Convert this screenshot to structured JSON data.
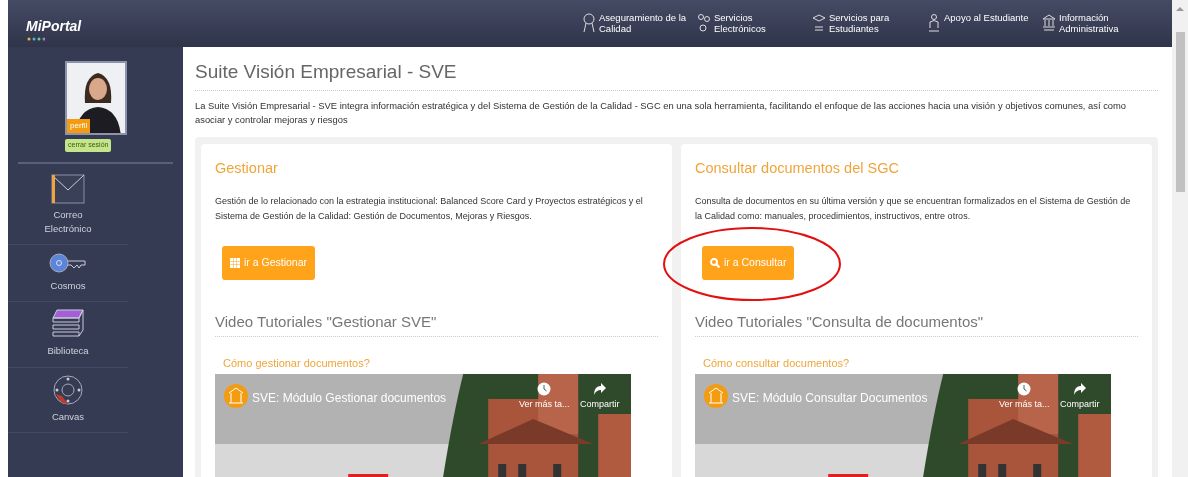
{
  "brand": {
    "text": "MiPortal"
  },
  "nav": [
    {
      "label": "Aseguramiento de la Calidad"
    },
    {
      "label": "Servicios Electrónicos"
    },
    {
      "label": "Servicios para Estudiantes"
    },
    {
      "label": "Apoyo al Estudiante"
    },
    {
      "label": "Información Administrativa"
    }
  ],
  "profile": {
    "edit_label": "perfil",
    "logout_label": "cerrar sesión"
  },
  "sidebar": {
    "items": [
      {
        "label": "Correo Electrónico"
      },
      {
        "label": "Cosmos"
      },
      {
        "label": "Biblioteca"
      },
      {
        "label": "Canvas"
      }
    ]
  },
  "page": {
    "title": "Suite Visión Empresarial - SVE",
    "intro": "La Suite Visión Empresarial - SVE integra información estratégica y del Sistema de Gestión de la Calidad - SGC en una sola herramienta, facilitando el enfoque de las acciones hacia una visión y objetivos comunes, así como asociar y controlar mejoras y riesgos"
  },
  "cards": [
    {
      "title": "Gestionar",
      "description": "Gestión de lo relacionado con la estrategia institucional: Balanced Score Card y Proyectos estratégicos y el Sistema de Gestión de la Calidad: Gestión de Documentos, Mejoras y Riesgos.",
      "button": "ir a Gestionar",
      "circled": false,
      "videos_heading": "Video Tutoriales \"Gestionar SVE\"",
      "video": {
        "link": "Cómo gestionar documentos?",
        "title": "SVE: Módulo Gestionar documentos",
        "more": "Ver más ta...",
        "share": "Compartir"
      }
    },
    {
      "title": "Consultar documentos del SGC",
      "description": "Consulta de documentos en su última versión y que se encuentran formalizados en el Sistema de Gestión de la Calidad como: manuales, procedimientos, instructivos, entre otros.",
      "button": "ir a Consultar",
      "circled": true,
      "videos_heading": "Video Tutoriales \"Consulta de documentos\"",
      "video": {
        "link": "Cómo consultar documentos?",
        "title": "SVE: Módulo Consultar Documentos",
        "more": "Ver más ta...",
        "share": "Compartir"
      }
    }
  ]
}
